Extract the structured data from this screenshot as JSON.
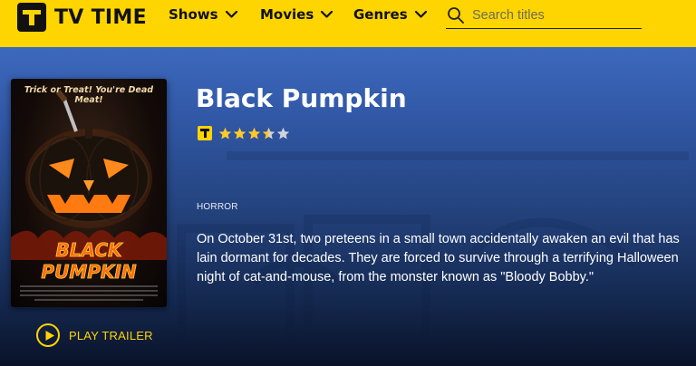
{
  "header": {
    "logo_text": "TV TIME",
    "nav": [
      {
        "label": "Shows"
      },
      {
        "label": "Movies"
      },
      {
        "label": "Genres"
      }
    ],
    "search": {
      "placeholder": "Search titles",
      "value": ""
    }
  },
  "show": {
    "title": "Black Pumpkin",
    "rating": 3.5,
    "rating_max": 5,
    "genre": "HORROR",
    "description": "On October 31st, two preteens in a small town accidentally awaken an evil that has lain dormant for decades. They are forced to survive through a terrifying Halloween night of cat-and-mouse, from the monster known as \"Bloody Bobby.\"",
    "poster": {
      "tagline": "Trick or Treat! You're Dead Meat!",
      "title_art": "BLACK PUMPKIN"
    },
    "trailer_label": "PLAY TRAILER"
  },
  "colors": {
    "brand_yellow": "#ffd500",
    "star_filled": "#ffc928",
    "star_empty": "#d0d4dc"
  },
  "icons": {
    "search": "search-icon",
    "chevron": "chevron-down-icon",
    "star": "star-icon",
    "play": "play-icon"
  }
}
